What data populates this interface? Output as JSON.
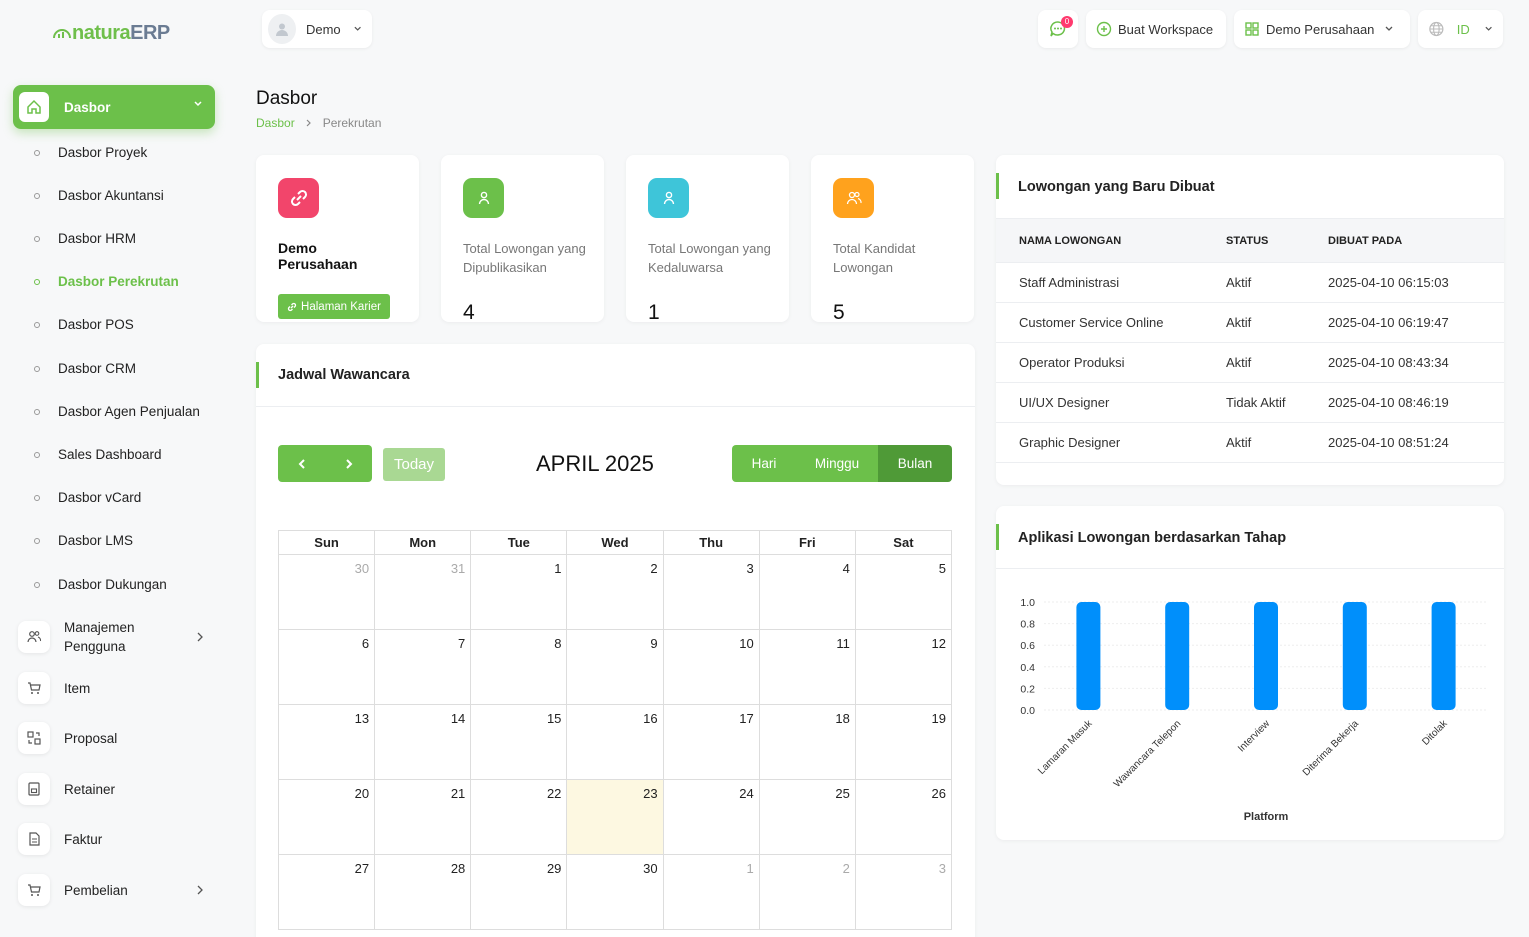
{
  "app": {
    "logo_main": "natura",
    "logo_suffix": "ERP"
  },
  "topbar": {
    "user": "Demo",
    "notif_count": "0",
    "create_workspace": "Buat Workspace",
    "company": "Demo Perusahaan",
    "lang": "ID"
  },
  "sidebar": {
    "active": "Dasbor",
    "sub_items": [
      {
        "label": "Dasbor Proyek"
      },
      {
        "label": "Dasbor Akuntansi"
      },
      {
        "label": "Dasbor HRM"
      },
      {
        "label": "Dasbor Perekrutan"
      },
      {
        "label": "Dasbor POS"
      },
      {
        "label": "Dasbor CRM"
      },
      {
        "label": "Dasbor Agen Penjualan"
      },
      {
        "label": "Sales Dashboard"
      },
      {
        "label": "Dasbor vCard"
      },
      {
        "label": "Dasbor LMS"
      },
      {
        "label": "Dasbor Dukungan"
      }
    ],
    "items": [
      {
        "label": "Manajemen Pengguna"
      },
      {
        "label": "Item"
      },
      {
        "label": "Proposal"
      },
      {
        "label": "Retainer"
      },
      {
        "label": "Faktur"
      },
      {
        "label": "Pembelian"
      }
    ]
  },
  "page": {
    "title": "Dasbor",
    "breadcrumb": [
      "Dasbor",
      "Perekrutan"
    ]
  },
  "stats": [
    {
      "label": "Demo Perusahaan",
      "button": "Halaman Karier",
      "color": "#f2456b"
    },
    {
      "label": "Total Lowongan yang Dipublikasikan",
      "value": "4",
      "color": "#6cc04a"
    },
    {
      "label": "Total Lowongan yang Kedaluwarsa",
      "value": "1",
      "color": "#3ec5d9"
    },
    {
      "label": "Total Kandidat Lowongan",
      "value": "5",
      "color": "#ffa21d"
    }
  ],
  "jobs": {
    "title": "Lowongan yang Baru Dibuat",
    "headers": [
      "NAMA LOWONGAN",
      "STATUS",
      "DIBUAT PADA"
    ],
    "rows": [
      [
        "Staff Administrasi",
        "Aktif",
        "2025-04-10 06:15:03"
      ],
      [
        "Customer Service Online",
        "Aktif",
        "2025-04-10 06:19:47"
      ],
      [
        "Operator Produksi",
        "Aktif",
        "2025-04-10 08:43:34"
      ],
      [
        "UI/UX Designer",
        "Tidak Aktif",
        "2025-04-10 08:46:19"
      ],
      [
        "Graphic Designer",
        "Aktif",
        "2025-04-10 08:51:24"
      ]
    ]
  },
  "calendar": {
    "title": "Jadwal Wawancara",
    "today_btn": "Today",
    "month": "APRIL 2025",
    "views": [
      "Hari",
      "Minggu",
      "Bulan"
    ],
    "days": [
      "Sun",
      "Mon",
      "Tue",
      "Wed",
      "Thu",
      "Fri",
      "Sat"
    ],
    "weeks": [
      [
        [
          "30",
          1
        ],
        [
          "31",
          1
        ],
        [
          "1",
          0
        ],
        [
          "2",
          0
        ],
        [
          "3",
          0
        ],
        [
          "4",
          0
        ],
        [
          "5",
          0
        ]
      ],
      [
        [
          "6",
          0
        ],
        [
          "7",
          0
        ],
        [
          "8",
          0
        ],
        [
          "9",
          0
        ],
        [
          "10",
          0
        ],
        [
          "11",
          0
        ],
        [
          "12",
          0
        ]
      ],
      [
        [
          "13",
          0
        ],
        [
          "14",
          0
        ],
        [
          "15",
          0
        ],
        [
          "16",
          0
        ],
        [
          "17",
          0
        ],
        [
          "18",
          0
        ],
        [
          "19",
          0
        ]
      ],
      [
        [
          "20",
          0
        ],
        [
          "21",
          0
        ],
        [
          "22",
          0
        ],
        [
          "23",
          2
        ],
        [
          "24",
          0
        ],
        [
          "25",
          0
        ],
        [
          "26",
          0
        ]
      ],
      [
        [
          "27",
          0
        ],
        [
          "28",
          0
        ],
        [
          "29",
          0
        ],
        [
          "30",
          0
        ],
        [
          "1",
          1
        ],
        [
          "2",
          1
        ],
        [
          "3",
          1
        ]
      ]
    ]
  },
  "chart_title": "Aplikasi Lowongan berdasarkan Tahap",
  "chart_data": {
    "type": "bar",
    "categories": [
      "Lamaran Masuk",
      "Wawancara Telepon",
      "Interview",
      "Diterima Bekerja",
      "Ditolak"
    ],
    "values": [
      1,
      1,
      1,
      1,
      1
    ],
    "xlabel": "Platform",
    "ylabel": "",
    "ylim": [
      0,
      1
    ],
    "yticks": [
      "0.0",
      "0.2",
      "0.4",
      "0.6",
      "0.8",
      "1.0"
    ],
    "color": "#008ffb",
    "grid": true
  }
}
